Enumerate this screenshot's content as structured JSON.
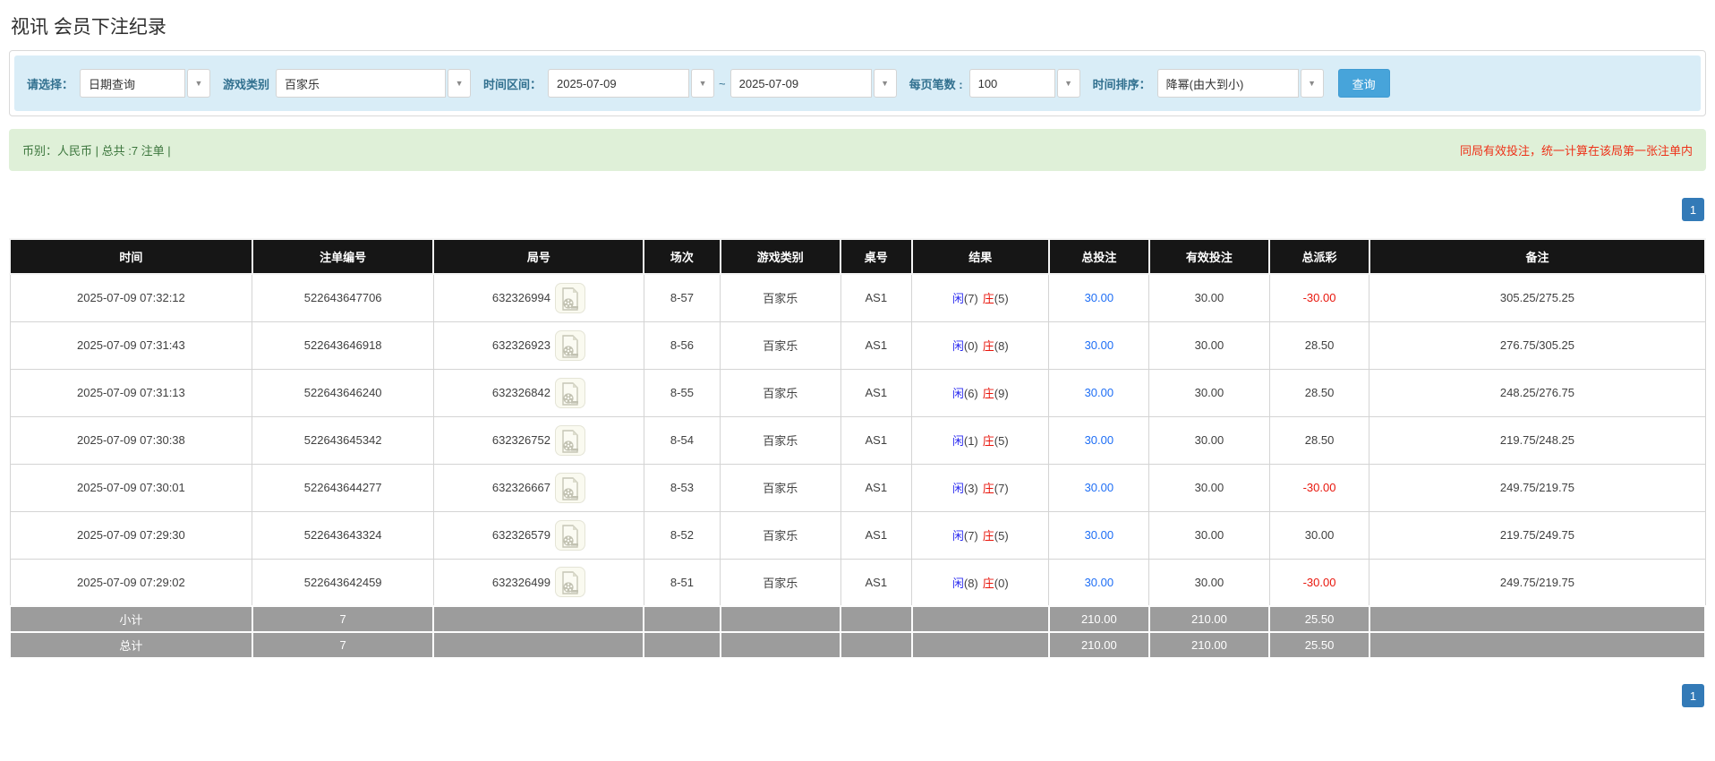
{
  "page": {
    "title": "视讯 会员下注纪录"
  },
  "icons": {
    "caret_down": "▼"
  },
  "filters": {
    "query_type": {
      "label": "请选择：",
      "value": "日期查询"
    },
    "game_type": {
      "label": "游戏类别",
      "value": "百家乐"
    },
    "date_range": {
      "label": "时间区间：",
      "from": "2025-07-09",
      "separator": "~",
      "to": "2025-07-09"
    },
    "page_size": {
      "label": "每页笔数 :",
      "value": "100"
    },
    "time_sort": {
      "label": "时间排序：",
      "value": "降幂(由大到小)"
    },
    "search_button": "查询"
  },
  "summary_bar": {
    "left_text": "币别：人民币 | 总共 :7 注单 |",
    "right_notice": "同局有效投注，统一计算在该局第一张注单内"
  },
  "pagination": {
    "page": "1"
  },
  "table": {
    "headers": [
      "时间",
      "注单编号",
      "局号",
      "场次",
      "游戏类别",
      "桌号",
      "结果",
      "总投注",
      "有效投注",
      "总派彩",
      "备注"
    ],
    "rows": [
      {
        "time": "2025-07-09 07:32:12",
        "bet_id": "522643647706",
        "round_id": "632326994",
        "session": "8-57",
        "game": "百家乐",
        "table_no": "AS1",
        "result_player_label": "闲",
        "result_player_num": "(7)",
        "result_banker_label": "庄",
        "result_banker_num": "(5)",
        "total_bet": "30.00",
        "valid_bet": "30.00",
        "payout": "-30.00",
        "remark": "305.25/275.25",
        "highlight": true
      },
      {
        "time": "2025-07-09 07:31:43",
        "bet_id": "522643646918",
        "round_id": "632326923",
        "session": "8-56",
        "game": "百家乐",
        "table_no": "AS1",
        "result_player_label": "闲",
        "result_player_num": "(0)",
        "result_banker_label": "庄",
        "result_banker_num": "(8)",
        "total_bet": "30.00",
        "valid_bet": "30.00",
        "payout": "28.50",
        "remark": "276.75/305.25",
        "highlight": false
      },
      {
        "time": "2025-07-09 07:31:13",
        "bet_id": "522643646240",
        "round_id": "632326842",
        "session": "8-55",
        "game": "百家乐",
        "table_no": "AS1",
        "result_player_label": "闲",
        "result_player_num": "(6)",
        "result_banker_label": "庄",
        "result_banker_num": "(9)",
        "total_bet": "30.00",
        "valid_bet": "30.00",
        "payout": "28.50",
        "remark": "248.25/276.75",
        "highlight": false
      },
      {
        "time": "2025-07-09 07:30:38",
        "bet_id": "522643645342",
        "round_id": "632326752",
        "session": "8-54",
        "game": "百家乐",
        "table_no": "AS1",
        "result_player_label": "闲",
        "result_player_num": "(1)",
        "result_banker_label": "庄",
        "result_banker_num": "(5)",
        "total_bet": "30.00",
        "valid_bet": "30.00",
        "payout": "28.50",
        "remark": "219.75/248.25",
        "highlight": false
      },
      {
        "time": "2025-07-09 07:30:01",
        "bet_id": "522643644277",
        "round_id": "632326667",
        "session": "8-53",
        "game": "百家乐",
        "table_no": "AS1",
        "result_player_label": "闲",
        "result_player_num": "(3)",
        "result_banker_label": "庄",
        "result_banker_num": "(7)",
        "total_bet": "30.00",
        "valid_bet": "30.00",
        "payout": "-30.00",
        "remark": "249.75/219.75",
        "highlight": false
      },
      {
        "time": "2025-07-09 07:29:30",
        "bet_id": "522643643324",
        "round_id": "632326579",
        "session": "8-52",
        "game": "百家乐",
        "table_no": "AS1",
        "result_player_label": "闲",
        "result_player_num": "(7)",
        "result_banker_label": "庄",
        "result_banker_num": "(5)",
        "total_bet": "30.00",
        "valid_bet": "30.00",
        "payout": "30.00",
        "remark": "219.75/249.75",
        "highlight": false
      },
      {
        "time": "2025-07-09 07:29:02",
        "bet_id": "522643642459",
        "round_id": "632326499",
        "session": "8-51",
        "game": "百家乐",
        "table_no": "AS1",
        "result_player_label": "闲",
        "result_player_num": "(8)",
        "result_banker_label": "庄",
        "result_banker_num": "(0)",
        "total_bet": "30.00",
        "valid_bet": "30.00",
        "payout": "-30.00",
        "remark": "249.75/219.75",
        "highlight": false
      }
    ],
    "subtotal": {
      "label": "小计",
      "count": "7",
      "total_bet": "210.00",
      "valid_bet": "210.00",
      "payout": "25.50"
    },
    "total": {
      "label": "总计",
      "count": "7",
      "total_bet": "210.00",
      "valid_bet": "210.00",
      "payout": "25.50"
    }
  },
  "colors": {
    "header_bg": "#161616",
    "highlight": "#fbfb9e",
    "link_blue": "#1e6ef5",
    "player_blue": "#2b2bf0",
    "banker_red": "#e8160c",
    "negative_red": "#e8160c",
    "success_bg": "#dff0d8",
    "success_text": "#3c763d",
    "notice_red": "#ee3118",
    "filter_bg": "#d9edf7",
    "label_blue": "#31708f",
    "summary_bg": "#9c9c9c",
    "accent_blue": "#47a4da",
    "pagination_blue": "#337ab7"
  }
}
